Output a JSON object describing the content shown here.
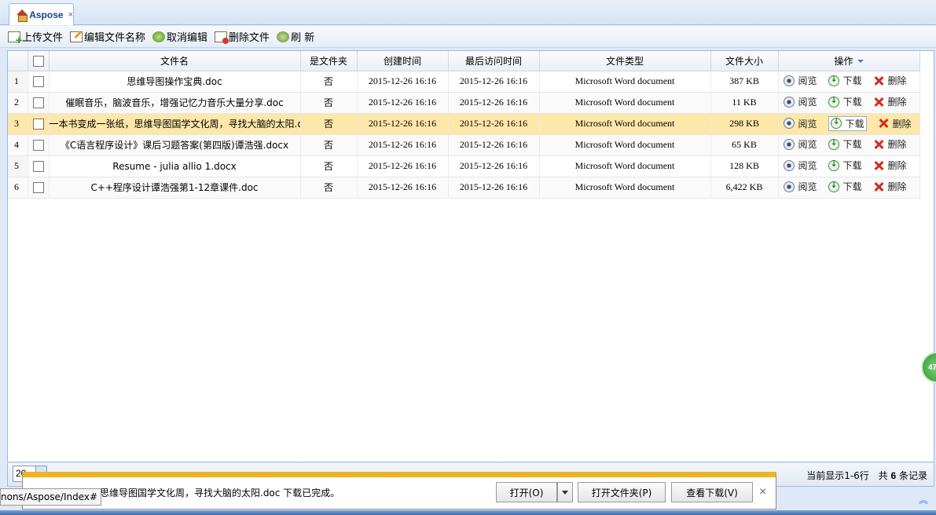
{
  "tab": {
    "label": "Aspose",
    "close": "×"
  },
  "toolbar": {
    "upload": "上传文件",
    "rename": "编辑文件名称",
    "cancel_edit": "取消编辑",
    "delete_file": "删除文件",
    "refresh": "刷 新"
  },
  "grid": {
    "headers": {
      "name": "文件名",
      "is_folder": "是文件夹",
      "created": "创建时间",
      "accessed": "最后访问时间",
      "type": "文件类型",
      "size": "文件大小",
      "ops": "操作"
    },
    "op_labels": {
      "view": "阅览",
      "download": "下载",
      "delete": "删除"
    },
    "rows": [
      {
        "n": "1",
        "name": "思维导图操作宝典.doc",
        "is_folder": "否",
        "created": "2015-12-26 16:16",
        "accessed": "2015-12-26 16:16",
        "type": "Microsoft Word document",
        "size": "387 KB"
      },
      {
        "n": "2",
        "name": "催眠音乐，脑波音乐，增强记忆力音乐大量分享.doc",
        "is_folder": "否",
        "created": "2015-12-26 16:16",
        "accessed": "2015-12-26 16:16",
        "type": "Microsoft Word document",
        "size": "11 KB"
      },
      {
        "n": "3",
        "name": "一本书变成一张纸，思维导图国学文化周，寻找大脑的太阳.doc",
        "is_folder": "否",
        "created": "2015-12-26 16:16",
        "accessed": "2015-12-26 16:16",
        "type": "Microsoft Word document",
        "size": "298 KB"
      },
      {
        "n": "4",
        "name": "《C语言程序设计》课后习题答案(第四版)谭浩强.docx",
        "is_folder": "否",
        "created": "2015-12-26 16:16",
        "accessed": "2015-12-26 16:16",
        "type": "Microsoft Word document",
        "size": "65 KB"
      },
      {
        "n": "5",
        "name": "Resume - julia allio 1.docx",
        "is_folder": "否",
        "created": "2015-12-26 16:16",
        "accessed": "2015-12-26 16:16",
        "type": "Microsoft Word document",
        "size": "128 KB"
      },
      {
        "n": "6",
        "name": "C++程序设计谭浩强第1-12章课件.doc",
        "is_folder": "否",
        "created": "2015-12-26 16:16",
        "accessed": "2015-12-26 16:16",
        "type": "Microsoft Word document",
        "size": "6,422 KB"
      }
    ]
  },
  "pager": {
    "page_size": "20",
    "showing": "当前显示1-6行",
    "total_prefix": "共",
    "total": "6",
    "total_suffix": "条记录"
  },
  "download_bar": {
    "message": "张纸，思维导图国学文化周，寻找大脑的太阳.doc 下载已完成。",
    "open": "打开(O)",
    "open_folder": "打开文件夹(P)",
    "view_downloads": "查看下载(V)",
    "close": "×"
  },
  "url_tooltip": "nons/Aspose/Index#",
  "side_badge": "47"
}
